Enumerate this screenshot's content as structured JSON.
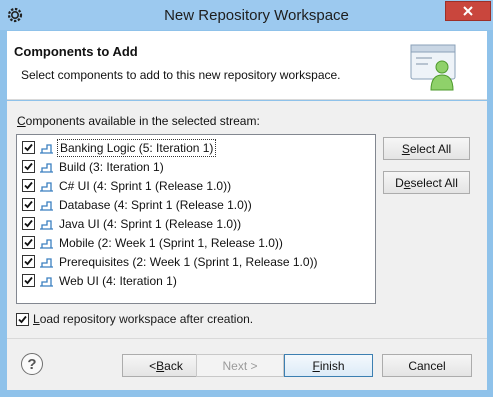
{
  "window": {
    "title": "New Repository Workspace",
    "app_icon": "gear-icon",
    "close_icon": "close-icon"
  },
  "banner": {
    "title": "Components to Add",
    "description": "Select components to add to this new repository workspace.",
    "icon": "workspace-user-icon"
  },
  "components": {
    "label_prefix": "",
    "label_mnemonic": "C",
    "label_rest": "omponents available in the selected stream:",
    "items": [
      {
        "label": "Banking Logic (5: Iteration 1)",
        "checked": true,
        "focused": true
      },
      {
        "label": "Build (3: Iteration 1)",
        "checked": true
      },
      {
        "label": "C# UI (4: Sprint 1 (Release 1.0))",
        "checked": true
      },
      {
        "label": "Database (4: Sprint 1 (Release 1.0))",
        "checked": true
      },
      {
        "label": "Java UI (4: Sprint 1 (Release 1.0))",
        "checked": true
      },
      {
        "label": "Mobile (2: Week 1 (Sprint 1, Release 1.0))",
        "checked": true
      },
      {
        "label": "Prerequisites (2: Week 1 (Sprint 1, Release 1.0))",
        "checked": true
      },
      {
        "label": "Web UI (4: Iteration 1)",
        "checked": true
      }
    ]
  },
  "buttons": {
    "select_all_mn": "S",
    "select_all_rest": "elect All",
    "deselect_all_pre": "D",
    "deselect_all_mn": "e",
    "deselect_all_rest": "select All",
    "back_pre": "< ",
    "back_mn": "B",
    "back_rest": "ack",
    "next": "Next >",
    "finish_mn": "F",
    "finish_rest": "inish",
    "cancel": "Cancel"
  },
  "load_option": {
    "mn": "L",
    "rest": "oad repository workspace after creation.",
    "checked": true
  },
  "help": {
    "glyph": "?",
    "icon": "help-icon"
  }
}
